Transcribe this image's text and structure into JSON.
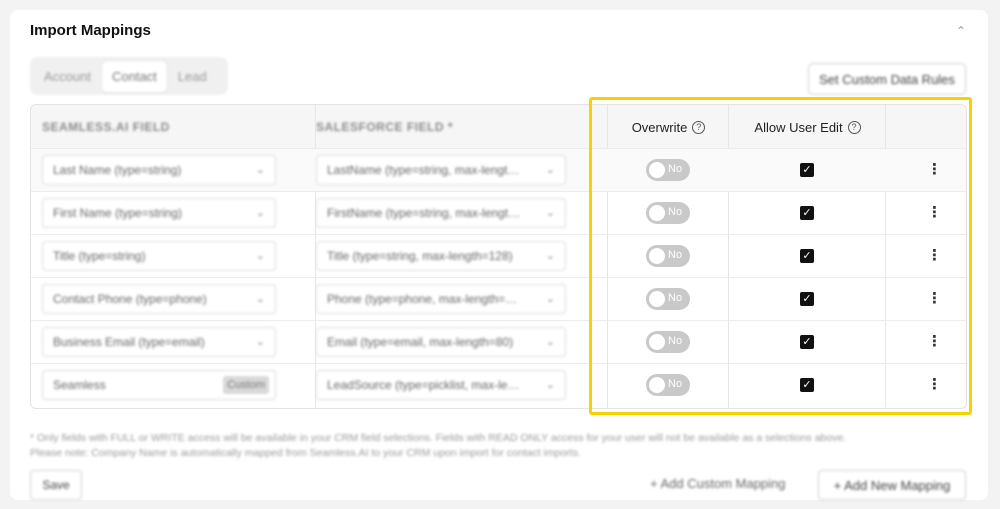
{
  "section": {
    "title": "Import Mappings",
    "collapse_icon": "chevron-up-icon"
  },
  "tabs": [
    {
      "label": "Account",
      "active": false
    },
    {
      "label": "Contact",
      "active": true
    },
    {
      "label": "Lead",
      "active": false
    }
  ],
  "set_rules_button": "Set Custom Data Rules",
  "table": {
    "headers": {
      "seamless": "SEAMLESS.AI FIELD",
      "salesforce": "SALESFORCE FIELD *",
      "overwrite": "Overwrite",
      "allow_edit": "Allow User Edit"
    },
    "rows": [
      {
        "seamless": "Last Name (type=string)",
        "salesforce": "LastName (type=string, max-lengt…",
        "overwrite": "No",
        "allow_edit": true
      },
      {
        "seamless": "First Name (type=string)",
        "salesforce": "FirstName (type=string, max-lengt…",
        "overwrite": "No",
        "allow_edit": true
      },
      {
        "seamless": "Title (type=string)",
        "salesforce": "Title (type=string, max-length=128)",
        "overwrite": "No",
        "allow_edit": true
      },
      {
        "seamless": "Contact Phone (type=phone)",
        "salesforce": "Phone (type=phone, max-length=…",
        "overwrite": "No",
        "allow_edit": true
      },
      {
        "seamless": "Business Email (type=email)",
        "salesforce": "Email (type=email, max-length=80)",
        "overwrite": "No",
        "allow_edit": true
      },
      {
        "seamless": "Seamless",
        "seamless_tag": "Custom",
        "salesforce": "LeadSource (type=picklist, max-le…",
        "overwrite": "No",
        "allow_edit": true
      }
    ]
  },
  "footnote": {
    "line1": "* Only fields with FULL or WRITE access will be available in your CRM field selections. Fields with READ ONLY access for your user will not be available as a selections above.",
    "line2": "Please note: Company Name is automatically mapped from Seamless.AI to your CRM upon import for contact imports."
  },
  "buttons": {
    "save": "Save",
    "add_custom": "+ Add Custom Mapping",
    "add_new": "+ Add New Mapping"
  },
  "colors": {
    "highlight": "#f4d300",
    "checkbox": "#111111",
    "toggle_off": "#c9c9c9"
  }
}
